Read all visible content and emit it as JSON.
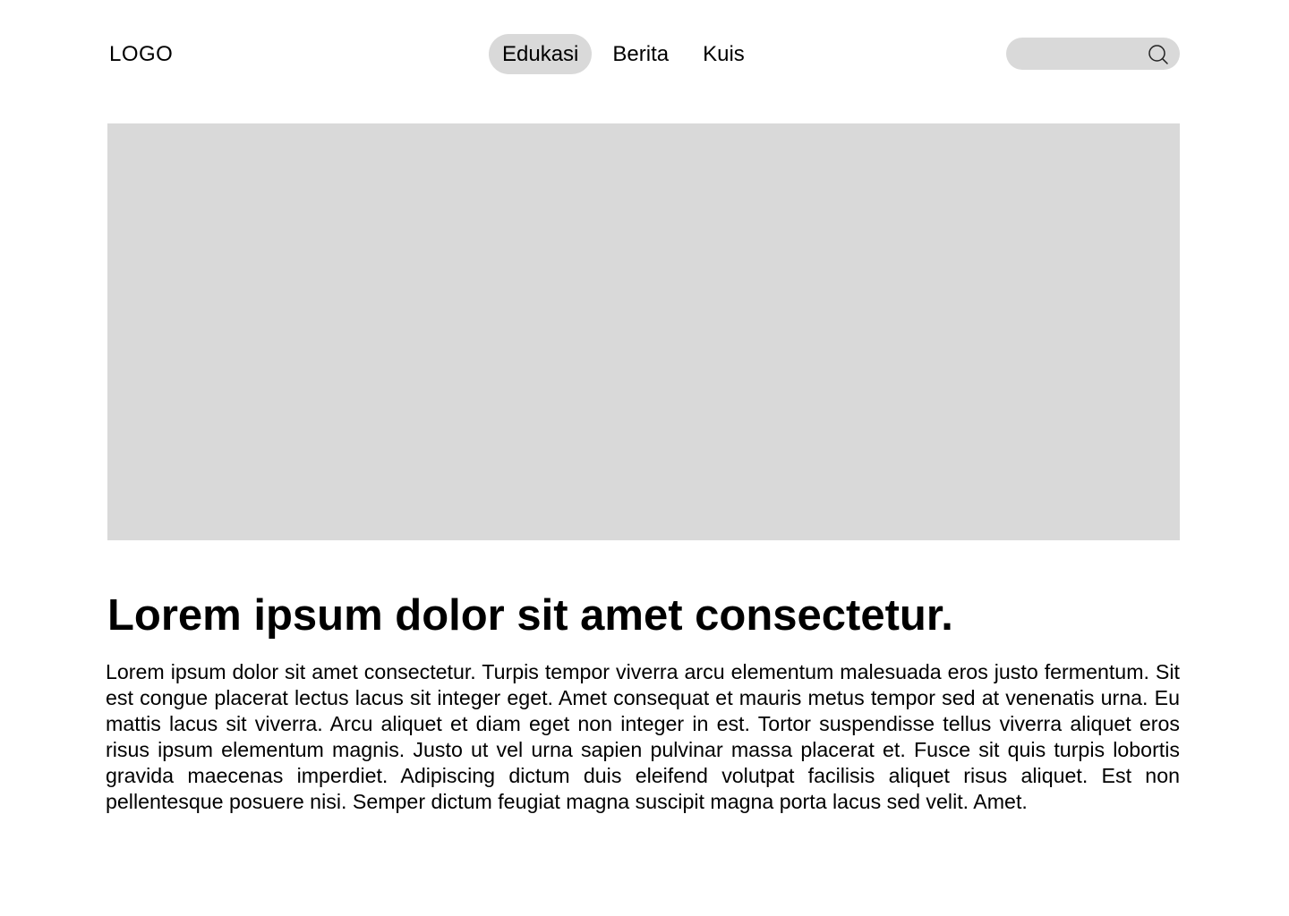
{
  "header": {
    "logo": "LOGO",
    "nav": [
      {
        "label": "Edukasi",
        "active": true
      },
      {
        "label": "Berita",
        "active": false
      },
      {
        "label": "Kuis",
        "active": false
      }
    ],
    "search": {
      "value": "",
      "placeholder": "",
      "icon": "search-icon"
    }
  },
  "article": {
    "image": "image-placeholder",
    "title": "Lorem ipsum dolor sit amet consectetur.",
    "body": "Lorem ipsum dolor sit amet consectetur. Turpis tempor viverra arcu elementum malesuada eros justo fermentum. Sit est congue placerat lectus lacus sit integer eget. Amet consequat et mauris metus tempor sed at venenatis urna. Eu mattis lacus sit viverra. Arcu aliquet et diam eget non integer in est. Tortor suspendisse tellus viverra aliquet eros risus ipsum elementum magnis. Justo ut vel urna sapien pulvinar massa placerat et. Fusce sit quis turpis lobortis gravida maecenas imperdiet. Adipiscing dictum duis eleifend volutpat facilisis aliquet risus aliquet. Est non pellentesque posuere nisi. Semper dictum feugiat magna suscipit magna porta lacus sed velit. Amet."
  },
  "colors": {
    "placeholder": "#d9d9d9",
    "text": "#000000",
    "background": "#ffffff"
  }
}
